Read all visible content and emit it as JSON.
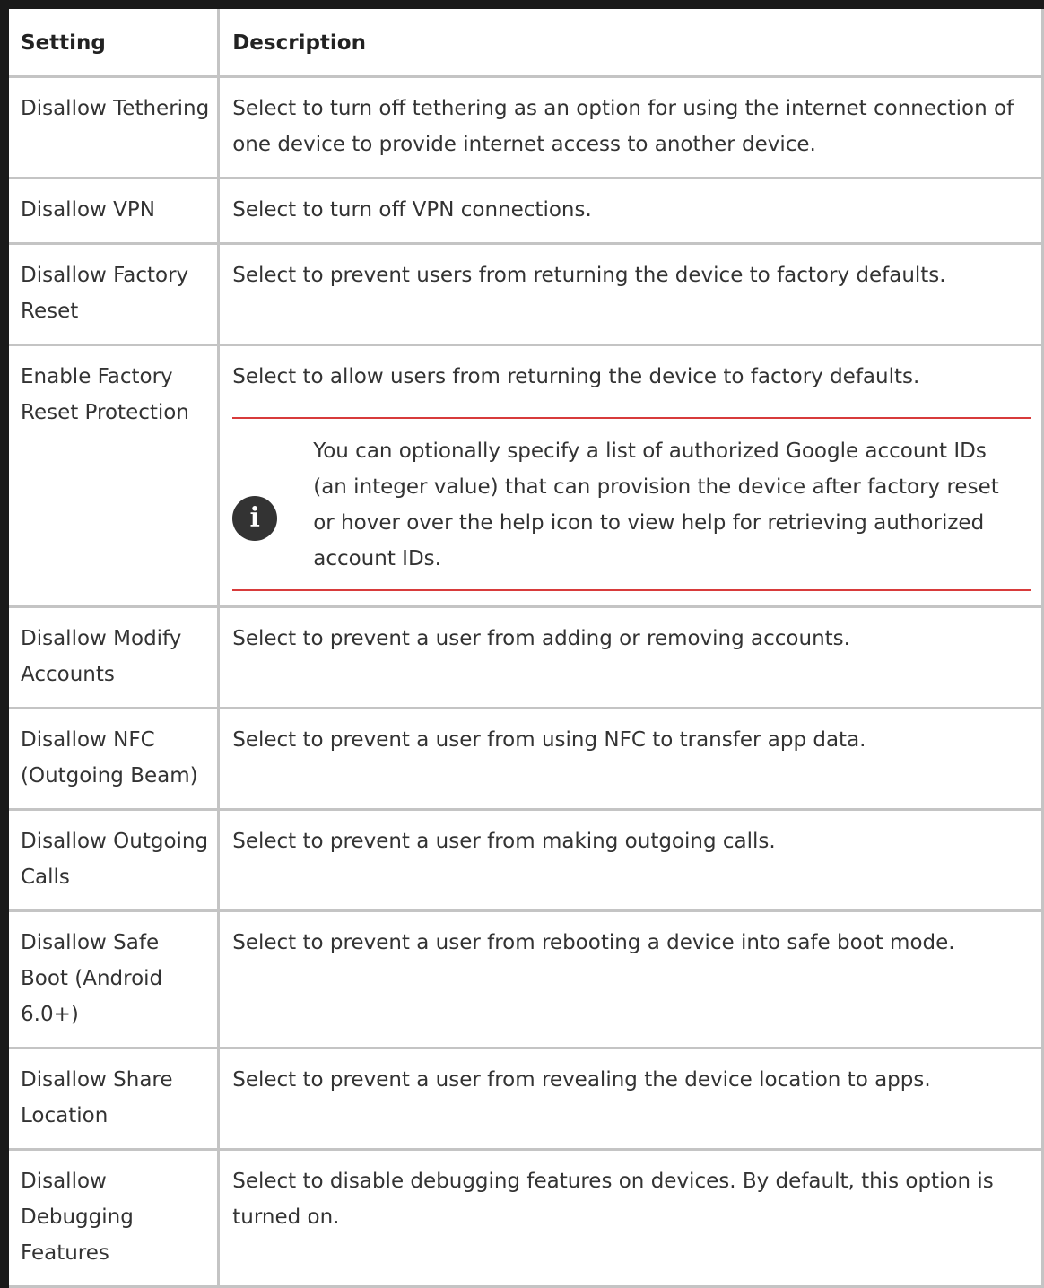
{
  "table": {
    "headers": {
      "setting": "Setting",
      "description": "Description"
    },
    "rows": [
      {
        "setting": "Disallow Tethering",
        "description": "Select to turn off tethering as an option for using the internet connection of one device to provide internet access to another device."
      },
      {
        "setting": "Disallow VPN",
        "description": "Select to turn off VPN connections."
      },
      {
        "setting": "Disallow Factory Reset",
        "description": "Select to prevent users from returning the device to factory defaults."
      },
      {
        "setting": "Enable Factory Reset Protection",
        "description": "Select to allow users from returning the device to factory defaults.",
        "note": {
          "icon": "info-icon",
          "icon_glyph": "i",
          "accent_color": "#d83b3b",
          "text": "You can optionally specify a list of authorized Google account IDs (an integer value) that can provision the device after factory reset or hover over the help icon to view help for retrieving authorized account IDs."
        }
      },
      {
        "setting": "Disallow Modify Accounts",
        "description": "Select to prevent a user from adding or removing accounts."
      },
      {
        "setting": "Disallow NFC (Outgoing Beam)",
        "description": "Select to prevent a user from using NFC to transfer app data."
      },
      {
        "setting": "Disallow Outgoing Calls",
        "description": "Select to prevent a user from making outgoing calls."
      },
      {
        "setting": "Disallow Safe Boot (Android 6.0+)",
        "description": "Select to prevent a user from rebooting a device into safe boot mode."
      },
      {
        "setting": "Disallow Share Location",
        "description": "Select to prevent a user from revealing the device location to apps."
      },
      {
        "setting": "Disallow Debugging Features",
        "description": "Select to disable debugging features on devices. By default, this option is turned on."
      }
    ]
  }
}
